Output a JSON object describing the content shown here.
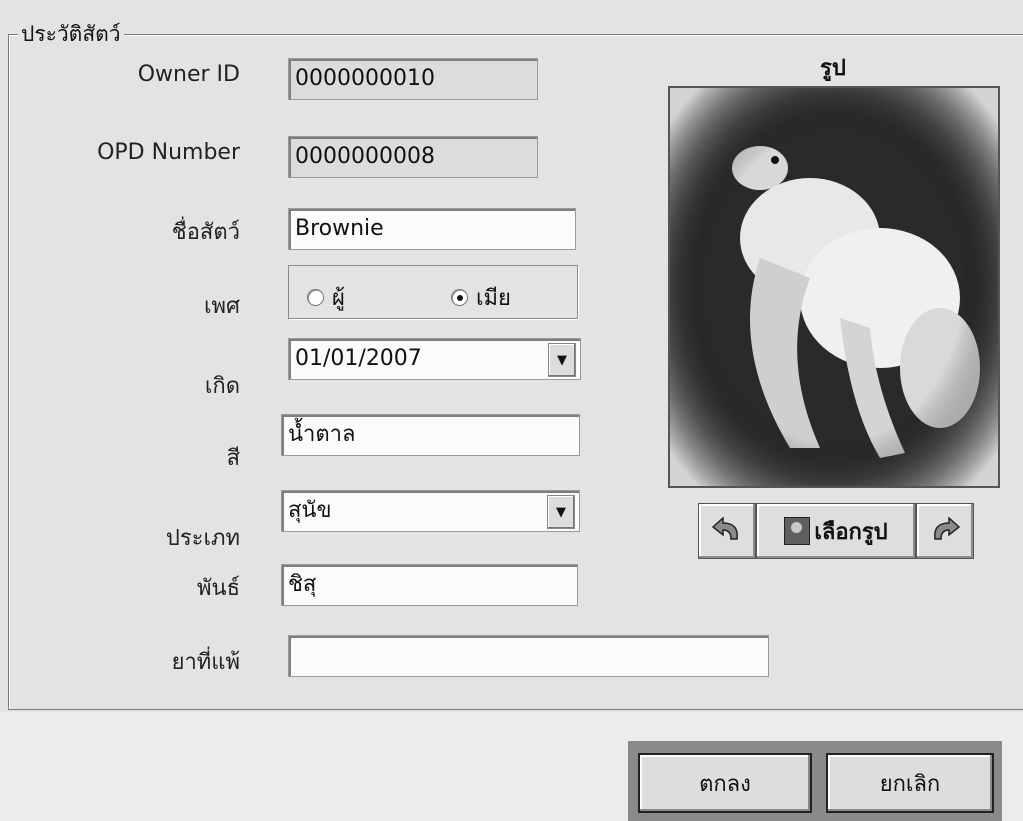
{
  "groupbox": {
    "title": "ประวัติสัตว์"
  },
  "fields": {
    "owner_id": {
      "label": "Owner ID",
      "value": "0000000010"
    },
    "opd_number": {
      "label": "OPD Number",
      "value": "0000000008"
    },
    "pet_name": {
      "label": "ชื่อสัตว์",
      "value": "Brownie"
    },
    "sex": {
      "label": "เพศ",
      "options": [
        "ผู้",
        "เมีย"
      ],
      "selected": "เมีย"
    },
    "birth": {
      "label": "เกิด",
      "value": "01/01/2007"
    },
    "color": {
      "label": "สี",
      "value": "น้ำตาล"
    },
    "type": {
      "label": "ประเภท",
      "value": "สุนัข"
    },
    "breed": {
      "label": "พันธ์",
      "value": "ชิสุ"
    },
    "allergy": {
      "label": "ยาที่แพ้",
      "value": ""
    }
  },
  "photo": {
    "title": "รูป",
    "choose_label": "เลือกรูป",
    "rotate_left_icon": "rotate-left-icon",
    "rotate_right_icon": "rotate-right-icon"
  },
  "buttons": {
    "ok": "ตกลง",
    "cancel": "ยกเลิก"
  }
}
